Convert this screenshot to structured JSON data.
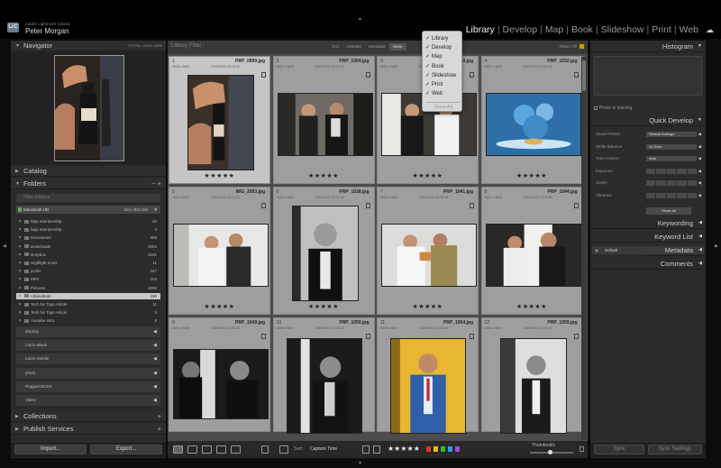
{
  "identity": {
    "product": "Adobe Lightroom Classic",
    "user": "Peter Morgan",
    "logo": "LrC"
  },
  "modules": [
    {
      "label": "Library",
      "active": true
    },
    {
      "label": "Develop",
      "active": false
    },
    {
      "label": "Map",
      "active": false
    },
    {
      "label": "Book",
      "active": false
    },
    {
      "label": "Slideshow",
      "active": false
    },
    {
      "label": "Print",
      "active": false
    },
    {
      "label": "Web",
      "active": false
    }
  ],
  "navigator": {
    "title": "Navigator",
    "options": "FIT  FILL  100%  100%"
  },
  "catalog": {
    "title": "Catalog"
  },
  "folders": {
    "title": "Folders",
    "search_placeholder": "Filter Folders",
    "volume": {
      "name": "Macintosh HD",
      "size": "104 / 931 GB"
    },
    "items": [
      {
        "name": "bipp membership",
        "count": "20"
      },
      {
        "name": "bipp membership",
        "count": "3"
      },
      {
        "name": "Documents",
        "count": "368"
      },
      {
        "name": "Downloads",
        "count": "2004"
      },
      {
        "name": "Dropbox",
        "count": "3181"
      },
      {
        "name": "Highlight Icons",
        "count": "11"
      },
      {
        "name": "jochis",
        "count": "347"
      },
      {
        "name": "MP2",
        "count": "104"
      },
      {
        "name": "Pictures",
        "count": "2096"
      },
      {
        "name": "robandleah",
        "count": "190",
        "selected": true
      },
      {
        "name": "Tech for Togs Article",
        "count": "11"
      },
      {
        "name": "Tech for Togs Article",
        "count": "3"
      },
      {
        "name": "Youtube intro",
        "count": "8"
      }
    ],
    "volumes": [
      "Backup",
      "LaCie Black",
      "LaCie Mobile",
      "photo",
      "Rugged BOSS",
      "Video"
    ]
  },
  "collections": {
    "title": "Collections"
  },
  "publish": {
    "title": "Publish Services"
  },
  "left_buttons": {
    "import": "Import...",
    "export": "Export..."
  },
  "filter_bar": {
    "label": "Library Filter :",
    "options": [
      "Text",
      "Attribute",
      "Metadata",
      "None"
    ],
    "active": "None",
    "status": "Filters Off"
  },
  "grid": [
    {
      "num": "1",
      "file": "PRP_0999.jpg",
      "dims": "3648 x 5600",
      "date": "22/09/2022 10:16:22",
      "stars": "★★★★★",
      "selected": true
    },
    {
      "num": "2",
      "file": "PRP_1004.jpg",
      "dims": "5600 x 3648",
      "date": "22/09/2022 10:17:42",
      "stars": "★★★★★"
    },
    {
      "num": "3",
      "file": "PRP_1019.jpg",
      "dims": "5600 x 3648",
      "date": "22/09/2022 10:22:15",
      "stars": "★★★★★"
    },
    {
      "num": "4",
      "file": "PRP_1032.jpg",
      "dims": "5600 x 3648",
      "date": "22/09/2022 10:24:46",
      "stars": "★★★★★"
    },
    {
      "num": "5",
      "file": "IMG_2093.jpg",
      "dims": "3000 x 4000",
      "date": "22/09/2022 10:31:06",
      "stars": "★★★★★"
    },
    {
      "num": "6",
      "file": "PRP_1038.jpg",
      "dims": "3648 x 5600",
      "date": "22/09/2022 10:31:42",
      "stars": "★★★★★"
    },
    {
      "num": "7",
      "file": "PRP_1041.jpg",
      "dims": "5600 x 3648",
      "date": "22/09/2022 10:33:08",
      "stars": "★★★★★"
    },
    {
      "num": "8",
      "file": "PRP_1044.jpg",
      "dims": "5600 x 3648",
      "date": "22/09/2022 10:33:55",
      "stars": "★★★★★"
    },
    {
      "num": "9",
      "file": "PRP_1049.jpg",
      "dims": "5600 x 3648",
      "date": "22/09/2022 10:35:10",
      "stars": ""
    },
    {
      "num": "10",
      "file": "PRP_1050.jpg",
      "dims": "3648 x 5600",
      "date": "22/09/2022 10:35:22",
      "stars": ""
    },
    {
      "num": "11",
      "file": "PRP_1054.jpg",
      "dims": "3648 x 5600",
      "date": "22/09/2022 10:36:09",
      "stars": ""
    },
    {
      "num": "12",
      "file": "PRP_1059.jpg",
      "dims": "3648 x 5600",
      "date": "22/09/2022 10:37:01",
      "stars": ""
    }
  ],
  "dropdown": {
    "items": [
      "Library",
      "Develop",
      "Map",
      "Book",
      "Slideshow",
      "Print",
      "Web"
    ],
    "show_all": "Show All"
  },
  "toolbar": {
    "sort_label": "Sort:",
    "sort_value": "Capture Time",
    "rating": "★★★★★",
    "color_labels": [
      "#d33",
      "#eb0",
      "#3b3",
      "#39e",
      "#a4d"
    ],
    "thumbnails_label": "Thumbnails"
  },
  "right_panel": {
    "histogram": "Histogram",
    "photo_missing": "Photo is missing",
    "quick_develop": "Quick Develop",
    "qd_rows": [
      {
        "label": "Saved Preset",
        "value": "Default Settings"
      },
      {
        "label": "White Balance",
        "value": "As Shot"
      },
      {
        "label": "Tone Control",
        "value": "Auto"
      },
      {
        "label": "Exposure",
        "value": ""
      },
      {
        "label": "Clarity",
        "value": ""
      },
      {
        "label": "Vibrance",
        "value": ""
      }
    ],
    "reset_all": "Reset All",
    "keywording": "Keywording",
    "keyword_list": "Keyword List",
    "metadata": "Metadata",
    "metadata_preset": "Default",
    "comments": "Comments",
    "sync": "Sync",
    "sync_settings": "Sync Settings"
  }
}
